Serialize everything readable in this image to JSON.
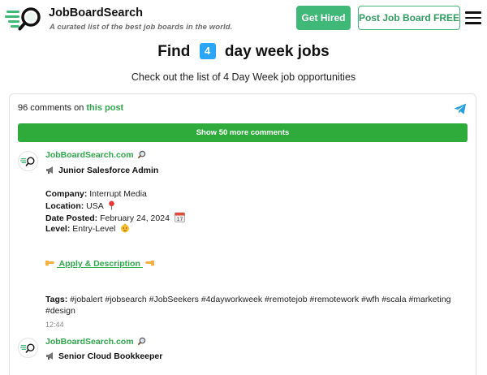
{
  "header": {
    "brand": "JobBoardSearch",
    "tagline": "A curated list of the best job boards in the world.",
    "get_hired": "Get Hired",
    "post_job_board": "Post Job Board FREE"
  },
  "page": {
    "title_before": "Find",
    "title_number": "4",
    "title_after": "day week jobs",
    "subtitle": "Check out the list of 4 Day Week job opportunities"
  },
  "comments": {
    "count_text": "96 comments on",
    "post_link": "this post",
    "show_more": "Show 50 more comments"
  },
  "posts": [
    {
      "author": "JobBoardSearch.com",
      "title": "Junior Salesforce Admin",
      "company_label": "Company:",
      "company": "Interrupt Media",
      "location_label": "Location:",
      "location": "USA",
      "date_label": "Date Posted:",
      "date": "February 24, 2024",
      "level_label": "Level:",
      "level": "Entry-Level",
      "apply": "Apply & Description",
      "tags_label": "Tags:",
      "tags": "#jobalert #jobsearch #JobSeekers #4dayworkweek #remotejob #remotework #wfh #scala #marketing #design",
      "time": "12:44"
    },
    {
      "author": "JobBoardSearch.com",
      "title": "Senior Cloud Bookkeeper"
    }
  ],
  "icons": {
    "logo": "search-magnifier-logo",
    "menu": "hamburger-menu-icon",
    "telegram": "telegram-paper-plane-icon",
    "megaphone": "megaphone-icon",
    "pin": "round-pushpin-icon",
    "calendar": "calendar-icon",
    "baby": "baby-icon",
    "hand": "pointing-hand-icon"
  },
  "colors": {
    "accent_green": "#3fb878",
    "link_green": "#2ea84a",
    "button_green": "#2eab3b",
    "badge_blue": "#2ba5f7",
    "telegram_blue": "#2aa0da"
  }
}
